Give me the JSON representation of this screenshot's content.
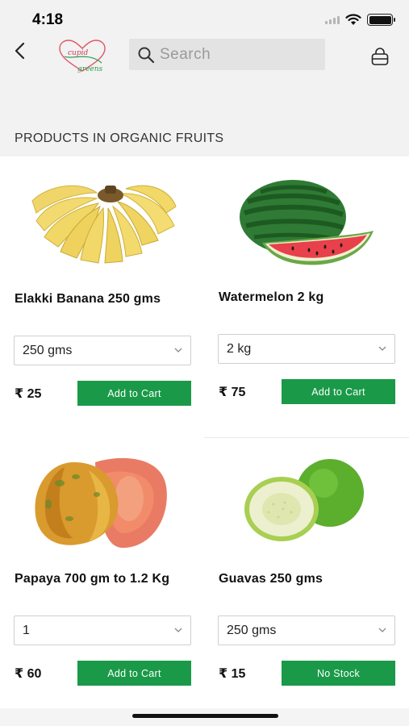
{
  "status_bar": {
    "time": "4:18"
  },
  "header": {
    "logo_text_line1": "cupid",
    "logo_text_line2": "greens",
    "search_placeholder": "Search"
  },
  "section_title": "PRODUCTS IN ORGANIC FRUITS",
  "products": [
    {
      "name": "Elakki Banana 250 gms",
      "variant": "250 gms",
      "price": "₹ 25",
      "button": "Add to Cart",
      "image": "banana-image"
    },
    {
      "name": "Watermelon 2 kg",
      "variant": "2 kg",
      "price": "₹ 75",
      "button": "Add to Cart",
      "image": "watermelon-image"
    },
    {
      "name": "Papaya 700 gm to 1.2 Kg",
      "variant": "1",
      "price": "₹ 60",
      "button": "Add to Cart",
      "image": "papaya-image"
    },
    {
      "name": "Guavas 250 gms",
      "variant": "250 gms",
      "price": "₹ 15",
      "button": "No Stock",
      "image": "guava-image"
    }
  ],
  "colors": {
    "accent_green": "#1a9a48",
    "header_bg": "#f2f2f2"
  }
}
